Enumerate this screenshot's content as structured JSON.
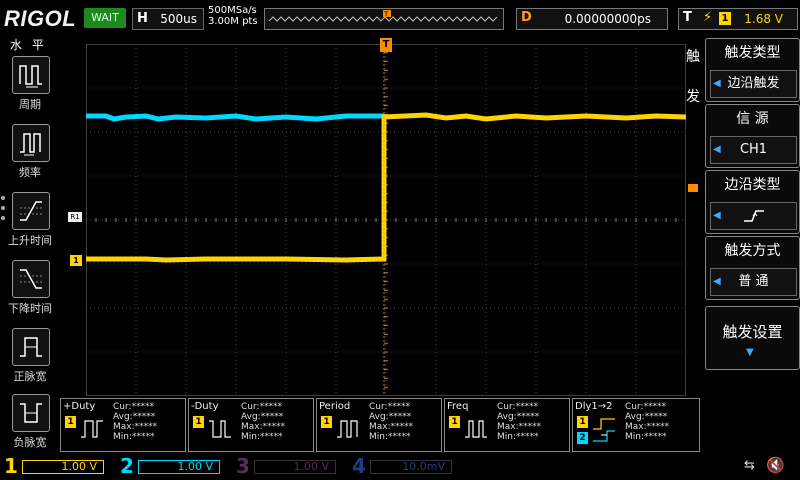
{
  "header": {
    "brand": "RIGOL",
    "run_status": "WAIT",
    "timebase_label": "H",
    "timebase_value": "500us",
    "sample_rate": "500MSa/s",
    "memory_depth": "3.00M pts",
    "delay_label": "D",
    "delay_value": "0.00000000ps",
    "trigger_label": "T",
    "trigger_icon": "rising-edge-icon",
    "trigger_channel": "1",
    "trigger_level": "1.68 V"
  },
  "left_menu": {
    "title": "水 平",
    "items": [
      {
        "label": "周期",
        "icon": "period-icon"
      },
      {
        "label": "频率",
        "icon": "frequency-icon"
      },
      {
        "label": "上升时间",
        "icon": "rise-time-icon"
      },
      {
        "label": "下降时间",
        "icon": "fall-time-icon"
      },
      {
        "label": "正脉宽",
        "icon": "positive-width-icon"
      },
      {
        "label": "负脉宽",
        "icon": "negative-width-icon"
      }
    ]
  },
  "right_menu": {
    "side_title_1": "触",
    "side_title_2": "发",
    "trigger_type_head": "触发类型",
    "trigger_type_value": "边沿触发",
    "source_head": "信 源",
    "source_value": "CH1",
    "edge_type_head": "边沿类型",
    "edge_type_icon": "rising-edge-icon",
    "sweep_head": "触发方式",
    "sweep_value": "普 通",
    "settings_label": "触发设置"
  },
  "markers": {
    "trigger_pos": "T",
    "ref_r1": "R1",
    "ch1_offset": "1"
  },
  "measurements": [
    {
      "title": "+Duty",
      "cur": "Cur:*****",
      "avg": "Avg:*****",
      "max": "Max:*****",
      "min": "Min:*****",
      "channel": "1"
    },
    {
      "title": "-Duty",
      "cur": "Cur:*****",
      "avg": "Avg:*****",
      "max": "Max:*****",
      "min": "Min:*****",
      "channel": "1"
    },
    {
      "title": "Period",
      "cur": "Cur:*****",
      "avg": "Avg:*****",
      "max": "Max:*****",
      "min": "Min:*****",
      "channel": "1"
    },
    {
      "title": "Freq",
      "cur": "Cur:*****",
      "avg": "Avg:*****",
      "max": "Max:*****",
      "min": "Min:*****",
      "channel": "1"
    },
    {
      "title": "Dly1→2",
      "cur": "Cur:*****",
      "avg": "Avg:*****",
      "max": "Max:*****",
      "min": "Min:*****",
      "channel": "1",
      "channel2": "2"
    }
  ],
  "channels": [
    {
      "num": "1",
      "scale": "1.00 V",
      "color": "#ffd400",
      "active": true
    },
    {
      "num": "2",
      "scale": "1.00 V",
      "color": "#00d8ff",
      "active": true
    },
    {
      "num": "3",
      "scale": "1.00 V",
      "color": "#c040c0",
      "active": false
    },
    {
      "num": "4",
      "scale": "10.0mV",
      "color": "#2a7fff",
      "active": false
    }
  ],
  "status_icons": [
    "usb-icon",
    "speaker-muted-icon"
  ],
  "colors": {
    "ch1": "#ffd400",
    "ch2": "#00d8ff",
    "trigger_marker": "#ff8c00",
    "run_status_bg": "#1e8a1e",
    "menu_arrow": "#3fa9ff"
  }
}
